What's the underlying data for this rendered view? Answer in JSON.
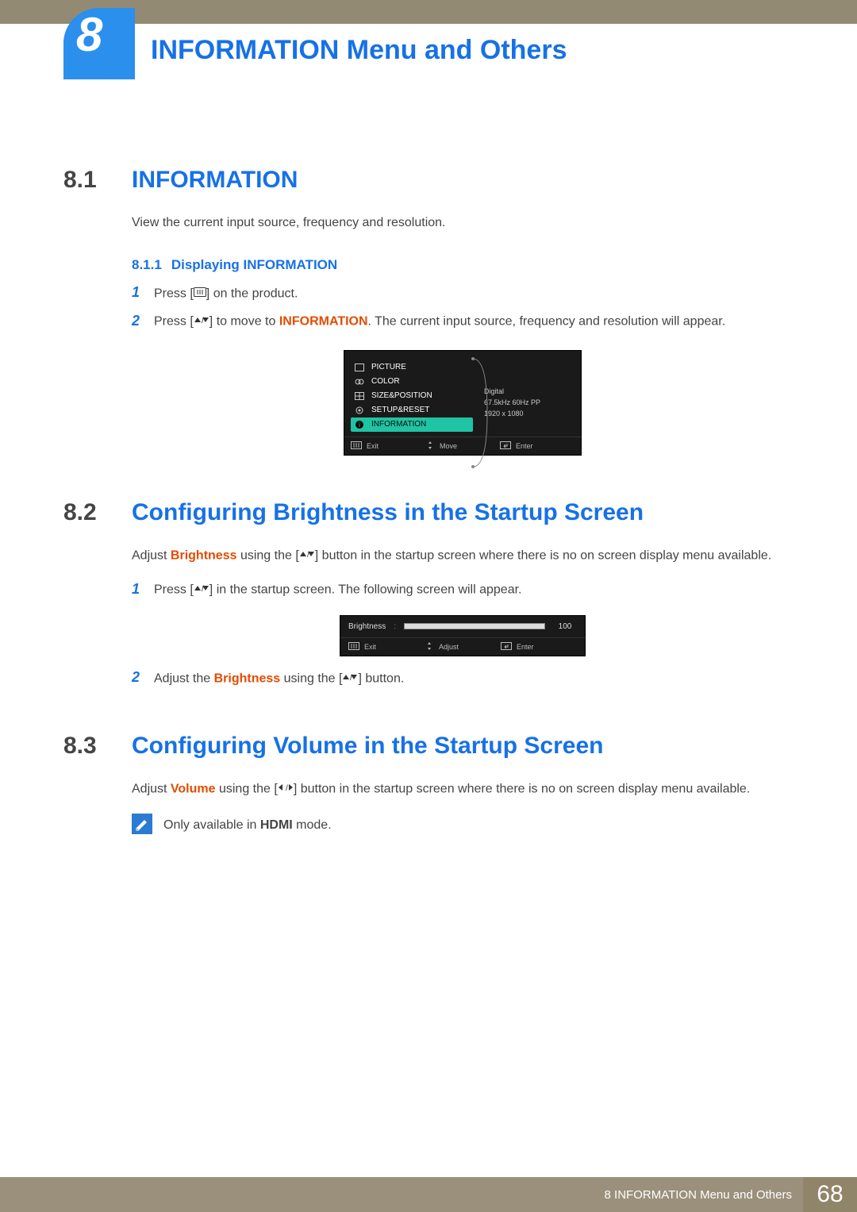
{
  "chapter": {
    "number": "8",
    "title": "INFORMATION Menu and Others"
  },
  "sections": {
    "s81": {
      "num": "8.1",
      "title": "INFORMATION",
      "intro": "View the current input source, frequency and resolution.",
      "sub": {
        "num": "8.1.1",
        "title": "Displaying INFORMATION",
        "step1_a": "Press [",
        "step1_b": "] on the product.",
        "step2_a": "Press [",
        "step2_b": "] to move to ",
        "step2_kw": "INFORMATION",
        "step2_c": ". The current input source, frequency and resolution will appear."
      }
    },
    "s82": {
      "num": "8.2",
      "title": "Configuring Brightness in the Startup Screen",
      "p1_a": "Adjust ",
      "p1_kw": "Brightness",
      "p1_b": " using the [",
      "p1_c": "] button in the startup screen where there is no on screen display menu available.",
      "step1_a": "Press [",
      "step1_b": "] in the startup screen. The following screen will appear.",
      "step2_a": "Adjust the ",
      "step2_kw": "Brightness",
      "step2_b": " using the [",
      "step2_c": "] button."
    },
    "s83": {
      "num": "8.3",
      "title": "Configuring Volume in the Startup Screen",
      "p1_a": "Adjust ",
      "p1_kw": "Volume",
      "p1_b": " using the [",
      "p1_c": "] button in the startup screen where there is no on screen display menu available.",
      "note_a": "Only available in ",
      "note_kw": "HDMI",
      "note_b": " mode."
    }
  },
  "osd1": {
    "menu": [
      "PICTURE",
      "COLOR",
      "SIZE&POSITION",
      "SETUP&RESET",
      "INFORMATION"
    ],
    "info": [
      "Digital",
      "67.5kHz 60Hz PP",
      "1920 x 1080"
    ],
    "bottom": {
      "exit": "Exit",
      "move": "Move",
      "enter": "Enter"
    }
  },
  "osd2": {
    "label": "Brightness",
    "value": "100",
    "bottom": {
      "exit": "Exit",
      "adjust": "Adjust",
      "enter": "Enter"
    }
  },
  "footer": {
    "text": "8 INFORMATION Menu and Others",
    "page": "68"
  }
}
